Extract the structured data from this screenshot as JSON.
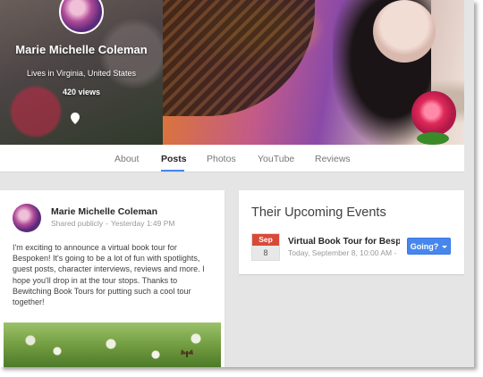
{
  "profile": {
    "name": "Marie Michelle Coleman",
    "location": "Lives in Virginia, United States",
    "views": "420 views"
  },
  "tabs": [
    {
      "label": "About",
      "active": false
    },
    {
      "label": "Posts",
      "active": true
    },
    {
      "label": "Photos",
      "active": false
    },
    {
      "label": "YouTube",
      "active": false
    },
    {
      "label": "Reviews",
      "active": false
    }
  ],
  "post": {
    "author": "Marie Michelle Coleman",
    "visibility": "Shared publicly",
    "separator": "-",
    "timestamp": "Yesterday 1:49 PM",
    "text": "I'm exciting to announce a virtual book tour for Bespoken! It's going to be a lot of fun with spotlights, guest posts, character interviews, reviews and more. I hope you'll drop in at the tour stops. Thanks to Bewitching Book Tours for putting such a cool tour together!"
  },
  "events": {
    "title": "Their Upcoming Events",
    "items": [
      {
        "month": "Sep",
        "day": "8",
        "name": "Virtual Book Tour for Bespoken",
        "time": "Today, September 8, 10:00 AM - ",
        "rsvp_label": "Going?"
      }
    ]
  },
  "colors": {
    "accent": "#4787ed",
    "date_red": "#d84a38"
  },
  "icons": {
    "location": "location-pin-icon",
    "dropdown": "chevron-down-icon"
  }
}
